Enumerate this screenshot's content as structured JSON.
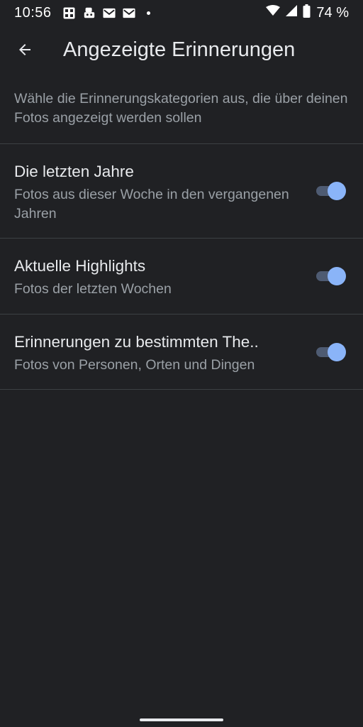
{
  "status_bar": {
    "time": "10:56",
    "battery": "74 %",
    "icons": [
      "grid-app-icon",
      "robot-app-icon",
      "gmail-icon",
      "gmail-icon",
      "notification-dot",
      "wifi-icon",
      "signal-icon",
      "battery-icon"
    ]
  },
  "app_bar": {
    "title": "Angezeigte Erinnerungen",
    "back_icon": "arrow-back-icon"
  },
  "description": "Wähle die Erinnerungskategorien aus, die über deinen Fotos angezeigt werden sollen",
  "settings": [
    {
      "title": "Die letzten Jahre",
      "subtitle": "Fotos aus dieser Woche in den vergangenen Jahren",
      "enabled": true
    },
    {
      "title": "Aktuelle Highlights",
      "subtitle": "Fotos der letzten Wochen",
      "enabled": true
    },
    {
      "title": "Erinnerungen zu bestimmten The..",
      "subtitle": "Fotos von Personen, Orten und Dingen",
      "enabled": true
    }
  ],
  "colors": {
    "background": "#202124",
    "toggle_on_thumb": "#8ab4f8",
    "toggle_on_track": "#4e5b72",
    "primary_text": "#e8eaed",
    "secondary_text": "#9aa0a6"
  }
}
